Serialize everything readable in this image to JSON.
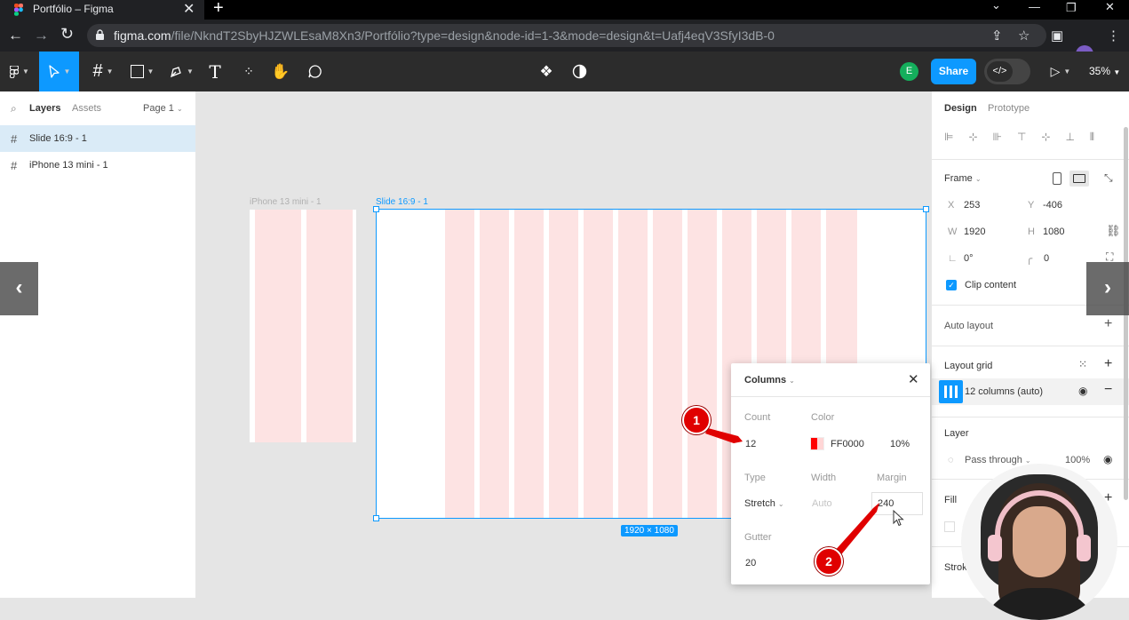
{
  "browser": {
    "tab_title": "Portfólio – Figma",
    "tab_close": "✕",
    "new_tab": "+",
    "url_host": "figma.com",
    "url_path": "/file/NkndT2SbyHJZWLEsaM8Xn3/Portfólio?type=design&node-id=1-3&mode=design&t=Uafj4eqV3SfyI3dB-0"
  },
  "toolbar": {
    "avatar_initial": "E",
    "share_label": "Share",
    "zoom_label": "35%"
  },
  "left_panel": {
    "tabs": [
      "Layers",
      "Assets"
    ],
    "page_selector": "Page 1",
    "layers": [
      {
        "name": "Slide 16:9 - 1",
        "selected": true
      },
      {
        "name": "iPhone 13 mini - 1",
        "selected": false
      }
    ]
  },
  "canvas": {
    "frame_labels": [
      "iPhone 13 mini - 1",
      "Slide 16:9 - 1"
    ],
    "size_badge": "1920 × 1080",
    "grid_color": "#fde3e3",
    "selection_color": "#0d99ff"
  },
  "right_panel": {
    "tabs": [
      "Design",
      "Prototype"
    ],
    "frame_section": "Frame",
    "x_label": "X",
    "x_value": "253",
    "y_label": "Y",
    "y_value": "-406",
    "w_label": "W",
    "w_value": "1920",
    "h_label": "H",
    "h_value": "1080",
    "rotation_value": "0°",
    "radius_value": "0",
    "clip_content_label": "Clip content",
    "clip_content_checked": true,
    "auto_layout_label": "Auto layout",
    "layout_grid_label": "Layout grid",
    "grid_entry_label": "12 columns (auto)",
    "layer_section": "Layer",
    "blend_mode": "Pass through",
    "layer_opacity": "100%",
    "fill_section": "Fill",
    "stroke_section": "Stroke"
  },
  "popover": {
    "title": "Columns",
    "count_label": "Count",
    "count_value": "12",
    "color_label": "Color",
    "color_hex": "FF0000",
    "color_opacity": "10%",
    "type_label": "Type",
    "type_value": "Stretch",
    "width_label": "Width",
    "width_value": "Auto",
    "margin_label": "Margin",
    "margin_value": "240",
    "gutter_label": "Gutter",
    "gutter_value": "20",
    "swatch_color": "#ff0000"
  },
  "annotations": [
    "1",
    "2"
  ],
  "icons": [
    "figma-logo-icon",
    "move-tool-icon",
    "frame-tool-icon",
    "shape-tool-icon",
    "pen-tool-icon",
    "text-tool-icon",
    "resources-icon",
    "hand-tool-icon",
    "comment-icon",
    "component-icon",
    "contrast-icon",
    "play-icon",
    "eye-icon"
  ]
}
